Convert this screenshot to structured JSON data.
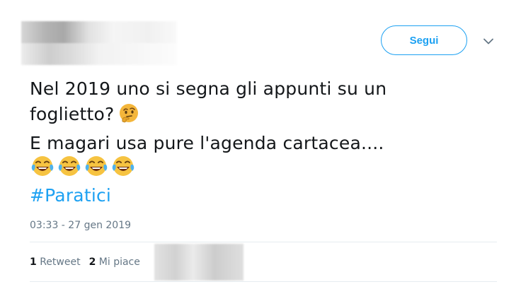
{
  "header": {
    "follow_label": "Segui",
    "menu_icon": "chevron-down-icon"
  },
  "tweet": {
    "line1": "Nel 2019 uno si segna gli appunti su un",
    "line2": "foglietto?",
    "line2_emoji": "thinking-face",
    "line3": "E magari usa pure l'agenda cartacea....",
    "laugh_emoji": "face-with-tears-of-joy",
    "laugh_count": 4,
    "hashtag": "#Paratici"
  },
  "meta": {
    "timestamp": "03:33 - 27 gen 2019"
  },
  "stats": {
    "retweets_count": "1",
    "retweets_label": "Retweet",
    "likes_count": "2",
    "likes_label": "Mi piace"
  },
  "colors": {
    "accent": "#1da1f2",
    "text": "#14171a",
    "muted": "#657786",
    "divider": "#e6ecf0"
  }
}
